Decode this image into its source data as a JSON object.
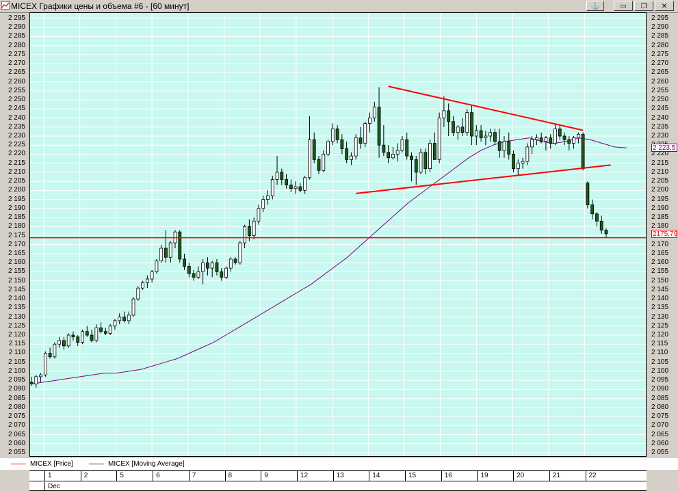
{
  "window": {
    "title": "MICEX Графики цены и объема #6 - [60 минут]",
    "buttons": [
      "⚓",
      "▭",
      "❐",
      "✕"
    ]
  },
  "legend": [
    {
      "name": "MICEX [Price]",
      "color": "#ff0000"
    },
    {
      "name": "MICEX [Moving Average]",
      "color": "#800080"
    }
  ],
  "price_boxes": {
    "ma": {
      "label": "2 223,5",
      "value": 2223.5,
      "color": "#800080"
    },
    "last": {
      "label": "2175,79",
      "value": 2175.79,
      "color": "#ff0000"
    }
  },
  "x_axis": {
    "days": [
      "1",
      "2",
      "5",
      "6",
      "7",
      "8",
      "9",
      "12",
      "13",
      "14",
      "15",
      "16",
      "19",
      "20",
      "21",
      "22"
    ],
    "month": "Dec"
  },
  "chart_data": {
    "type": "candlestick",
    "title": "",
    "ylim": [
      2055,
      2295
    ],
    "y_tick_step": 5,
    "grid": true,
    "colors": {
      "up": "#ffffff",
      "down": "#1a5c1a",
      "wick": "#000000",
      "background": "#c8f8ef"
    },
    "candles": [
      [
        2094,
        2097,
        2092,
        2093
      ],
      [
        2093,
        2098,
        2091,
        2097
      ],
      [
        2097,
        2099,
        2094,
        2098
      ],
      [
        2098,
        2111,
        2097,
        2110
      ],
      [
        2110,
        2113,
        2107,
        2108
      ],
      [
        2108,
        2116,
        2107,
        2115
      ],
      [
        2115,
        2119,
        2113,
        2117
      ],
      [
        2117,
        2119,
        2112,
        2114
      ],
      [
        2114,
        2121,
        2113,
        2120
      ],
      [
        2120,
        2122,
        2117,
        2119
      ],
      [
        2119,
        2120,
        2114,
        2116
      ],
      [
        2116,
        2123,
        2115,
        2122
      ],
      [
        2122,
        2125,
        2119,
        2120
      ],
      [
        2120,
        2123,
        2116,
        2117
      ],
      [
        2117,
        2126,
        2116,
        2124
      ],
      [
        2124,
        2127,
        2121,
        2122
      ],
      [
        2122,
        2124,
        2120,
        2121
      ],
      [
        2121,
        2126,
        2120,
        2125
      ],
      [
        2125,
        2129,
        2123,
        2128
      ],
      [
        2128,
        2132,
        2126,
        2130
      ],
      [
        2130,
        2133,
        2127,
        2128
      ],
      [
        2128,
        2133,
        2126,
        2131
      ],
      [
        2131,
        2141,
        2130,
        2140
      ],
      [
        2140,
        2147,
        2139,
        2146
      ],
      [
        2146,
        2150,
        2145,
        2149
      ],
      [
        2149,
        2153,
        2146,
        2151
      ],
      [
        2151,
        2156,
        2149,
        2155
      ],
      [
        2155,
        2162,
        2154,
        2161
      ],
      [
        2161,
        2170,
        2160,
        2168
      ],
      [
        2168,
        2178,
        2160,
        2163
      ],
      [
        2163,
        2172,
        2160,
        2171
      ],
      [
        2171,
        2178,
        2168,
        2177
      ],
      [
        2177,
        2178,
        2160,
        2162
      ],
      [
        2162,
        2165,
        2156,
        2158
      ],
      [
        2158,
        2160,
        2152,
        2154
      ],
      [
        2154,
        2156,
        2150,
        2152
      ],
      [
        2152,
        2158,
        2151,
        2155
      ],
      [
        2155,
        2162,
        2148,
        2160
      ],
      [
        2160,
        2163,
        2153,
        2157
      ],
      [
        2157,
        2161,
        2152,
        2160
      ],
      [
        2160,
        2162,
        2153,
        2155
      ],
      [
        2155,
        2157,
        2150,
        2152
      ],
      [
        2152,
        2158,
        2151,
        2157
      ],
      [
        2157,
        2163,
        2155,
        2162
      ],
      [
        2162,
        2163,
        2159,
        2160
      ],
      [
        2160,
        2172,
        2159,
        2171
      ],
      [
        2171,
        2181,
        2168,
        2180
      ],
      [
        2180,
        2184,
        2172,
        2175
      ],
      [
        2175,
        2185,
        2173,
        2183
      ],
      [
        2183,
        2192,
        2181,
        2190
      ],
      [
        2190,
        2197,
        2188,
        2195
      ],
      [
        2195,
        2200,
        2192,
        2197
      ],
      [
        2197,
        2208,
        2195,
        2206
      ],
      [
        2206,
        2219,
        2203,
        2210
      ],
      [
        2210,
        2212,
        2203,
        2206
      ],
      [
        2206,
        2209,
        2201,
        2203
      ],
      [
        2203,
        2206,
        2199,
        2201
      ],
      [
        2201,
        2205,
        2198,
        2202
      ],
      [
        2202,
        2204,
        2199,
        2200
      ],
      [
        2200,
        2208,
        2198,
        2207
      ],
      [
        2207,
        2241,
        2206,
        2228
      ],
      [
        2228,
        2232,
        2215,
        2217
      ],
      [
        2217,
        2219,
        2209,
        2211
      ],
      [
        2211,
        2222,
        2210,
        2220
      ],
      [
        2220,
        2228,
        2219,
        2227
      ],
      [
        2227,
        2237,
        2225,
        2234
      ],
      [
        2234,
        2236,
        2226,
        2228
      ],
      [
        2228,
        2231,
        2220,
        2223
      ],
      [
        2223,
        2227,
        2215,
        2217
      ],
      [
        2217,
        2221,
        2214,
        2219
      ],
      [
        2219,
        2231,
        2217,
        2229
      ],
      [
        2229,
        2235,
        2223,
        2226
      ],
      [
        2226,
        2238,
        2224,
        2237
      ],
      [
        2237,
        2243,
        2232,
        2240
      ],
      [
        2240,
        2249,
        2238,
        2246
      ],
      [
        2246,
        2257,
        2218,
        2225
      ],
      [
        2225,
        2236,
        2219,
        2221
      ],
      [
        2221,
        2225,
        2215,
        2218
      ],
      [
        2218,
        2224,
        2217,
        2220
      ],
      [
        2220,
        2226,
        2216,
        2222
      ],
      [
        2222,
        2230,
        2221,
        2228
      ],
      [
        2228,
        2232,
        2217,
        2219
      ],
      [
        2219,
        2221,
        2205,
        2217
      ],
      [
        2217,
        2219,
        2203,
        2210
      ],
      [
        2210,
        2223,
        2209,
        2221
      ],
      [
        2221,
        2223,
        2209,
        2212
      ],
      [
        2212,
        2228,
        2210,
        2226
      ],
      [
        2226,
        2232,
        2220,
        2217
      ],
      [
        2217,
        2243,
        2215,
        2240
      ],
      [
        2240,
        2252,
        2235,
        2244
      ],
      [
        2244,
        2248,
        2230,
        2238
      ],
      [
        2238,
        2241,
        2230,
        2232
      ],
      [
        2232,
        2236,
        2228,
        2235
      ],
      [
        2235,
        2240,
        2230,
        2232
      ],
      [
        2232,
        2245,
        2230,
        2243
      ],
      [
        2243,
        2247,
        2225,
        2230
      ],
      [
        2230,
        2236,
        2225,
        2233
      ],
      [
        2233,
        2236,
        2227,
        2229
      ],
      [
        2229,
        2233,
        2225,
        2230
      ],
      [
        2230,
        2234,
        2227,
        2232
      ],
      [
        2232,
        2234,
        2225,
        2227
      ],
      [
        2227,
        2234,
        2218,
        2222
      ],
      [
        2222,
        2230,
        2218,
        2227
      ],
      [
        2227,
        2232,
        2217,
        2220
      ],
      [
        2220,
        2222,
        2210,
        2212
      ],
      [
        2212,
        2217,
        2208,
        2215
      ],
      [
        2215,
        2218,
        2212,
        2216
      ],
      [
        2216,
        2226,
        2214,
        2224
      ],
      [
        2224,
        2230,
        2220,
        2228
      ],
      [
        2228,
        2231,
        2225,
        2229
      ],
      [
        2229,
        2232,
        2226,
        2227
      ],
      [
        2227,
        2230,
        2222,
        2229
      ],
      [
        2229,
        2231,
        2223,
        2226
      ],
      [
        2226,
        2237,
        2225,
        2234
      ],
      [
        2234,
        2236,
        2228,
        2230
      ],
      [
        2230,
        2232,
        2225,
        2228
      ],
      [
        2228,
        2230,
        2222,
        2226
      ],
      [
        2226,
        2230,
        2223,
        2229
      ],
      [
        2229,
        2232,
        2226,
        2231
      ],
      [
        2231,
        2232,
        2211,
        2212
      ],
      [
        2204,
        2205,
        2190,
        2192
      ],
      [
        2192,
        2195,
        2184,
        2187
      ],
      [
        2187,
        2188,
        2180,
        2183
      ],
      [
        2183,
        2186,
        2176,
        2178
      ],
      [
        2178,
        2179,
        2174,
        2176
      ]
    ],
    "moving_average": [
      2093,
      2094,
      2095,
      2096,
      2097,
      2098,
      2099,
      2099,
      2100,
      2101,
      2103,
      2105,
      2107,
      2110,
      2113,
      2116,
      2120,
      2124,
      2128,
      2132,
      2136,
      2140,
      2144,
      2148,
      2153,
      2158,
      2163,
      2169,
      2175,
      2181,
      2187,
      2193,
      2198,
      2203,
      2208,
      2213,
      2218,
      2222,
      2225,
      2227,
      2228,
      2229,
      2227,
      2226,
      2227,
      2229,
      2228,
      2226,
      2224,
      2223.5
    ],
    "lines": [
      {
        "name": "",
        "color": "#ff0000",
        "points": [
          [
            70,
            2198.3
          ],
          [
            125,
            2214
          ]
        ]
      },
      {
        "name": "",
        "color": "#ff0000",
        "points": [
          [
            77,
            2257.5
          ],
          [
            119,
            2233.2
          ]
        ]
      }
    ],
    "hline": {
      "value": 2173.8,
      "color": "#ff0000"
    }
  }
}
